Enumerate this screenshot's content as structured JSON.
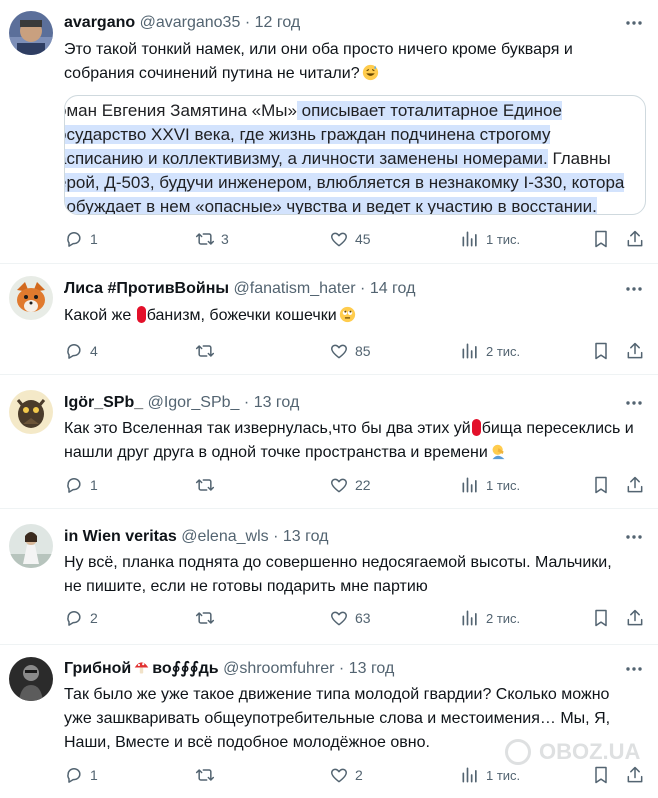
{
  "tweets": [
    {
      "name": "avargano",
      "handle": "@avargano35",
      "sep": "·",
      "time": "12 год",
      "text_lines": [
        "Это такой тонкий намек, или они оба просто ничего кроме букваря и",
        "собрания сочинений путина не читали?"
      ],
      "emoji": "grinning-sweat-emoji",
      "quote": {
        "l1_plain": "оман Евгения Замятина «Мы»",
        "l1_hl": " описывает тоталитарное Единое",
        "l2": "осударство XXVI века, где жизнь граждан подчинена строгому",
        "l3": "асписанию и коллективизму, а личности заменены номерами.",
        "l3_tail": " Главны",
        "l4": "ерой, Д-503, будучи инженером, влюбляется в незнакомку I-330, котора",
        "l5": "робуждает в нем «опасные» чувства и ведет к участию в восстании."
      },
      "replies": "1",
      "retweets": "3",
      "likes": "45",
      "views": "1 тис."
    },
    {
      "name": "Лиса #ПротивВойны",
      "handle": "@fanatism_hater",
      "sep": "·",
      "time": "14 год",
      "text_a": "Какой же ",
      "text_b": "банизм, божечки кошечки",
      "emoji": "rolling-eyes-emoji",
      "replies": "4",
      "retweets": "",
      "likes": "85",
      "views": "2 тис."
    },
    {
      "name": "Igör_SPb_",
      "handle": "@Igor_SPb_",
      "sep": "·",
      "time": "13 год",
      "line1_a": "Как это Вселенная так извернулась,что бы два этих уй",
      "line1_b": "бища пересеклись и",
      "line2": "нашли друг друга в одной точке пространства и времени",
      "emoji": "facepalm-emoji",
      "replies": "1",
      "retweets": "",
      "likes": "22",
      "views": "1 тис."
    },
    {
      "name": "in Wien veritas",
      "handle": "@elena_wls",
      "sep": "·",
      "time": "13 год",
      "text_lines": [
        "Ну всё, планка поднята до совершенно недосягаемой высоты. Мальчики,",
        "не пишите, если не готовы подарить мне партию"
      ],
      "replies": "2",
      "retweets": "",
      "likes": "63",
      "views": "2 тис."
    },
    {
      "name_a": "Грибной",
      "name_b": "во∮∮∮дь",
      "handle": "@shroomfuhrer",
      "sep": "·",
      "time": "13 год",
      "text_lines": [
        "Так было же уже такое движение типа молодой гвардии? Сколько можно",
        "уже зашкваривать общеупотребительные слова и местоимения… Мы, Я,",
        "Наши, Вместе и всё подобное молодёжное овно."
      ],
      "replies": "1",
      "retweets": "",
      "likes": "2",
      "views": "1 тис."
    }
  ],
  "watermark": "OBOZ.UA",
  "colors": {
    "text": "#0f1419",
    "muted": "#536471",
    "divider": "#eff3f4",
    "highlight": "#d3e3fd"
  }
}
